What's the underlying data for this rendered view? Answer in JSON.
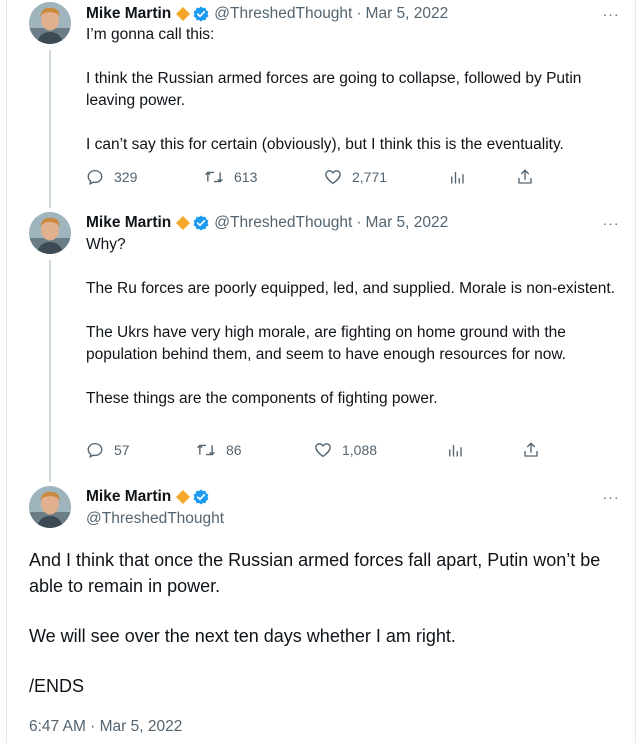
{
  "tweets": [
    {
      "author": {
        "name": "Mike Martin",
        "handle": "@ThreshedThought"
      },
      "separator": "·",
      "date": "Mar 5, 2022",
      "more_label": "···",
      "paragraphs": [
        "I’m gonna call this:",
        "I think the Russian armed forces are going to collapse, followed by Putin leaving power.",
        "I can’t say this for certain (obviously), but I think this is the eventuality."
      ],
      "stats": {
        "replies": "329",
        "retweets": "613",
        "likes": "2,771"
      }
    },
    {
      "author": {
        "name": "Mike Martin",
        "handle": "@ThreshedThought"
      },
      "separator": "·",
      "date": "Mar 5, 2022",
      "more_label": "···",
      "paragraphs": [
        "Why?",
        "The Ru forces are poorly equipped, led, and supplied. Morale is non-existent.",
        "The Ukrs have very high morale, are fighting on home ground with the population behind them, and seem to have enough resources for now.",
        "These things are the components of fighting power."
      ],
      "stats": {
        "replies": "57",
        "retweets": "86",
        "likes": "1,088"
      }
    }
  ],
  "main_tweet": {
    "author": {
      "name": "Mike Martin",
      "handle": "@ThreshedThought"
    },
    "more_label": "···",
    "paragraphs": [
      "And I think that once the Russian armed forces fall apart, Putin won’t be able to remain in power.",
      "We will see over the next ten days whether I am right.",
      "/ENDS"
    ],
    "timestamp": "6:47 AM · Mar 5, 2022"
  },
  "colors": {
    "text": "#0f1419",
    "secondary": "#536471",
    "verified_blue": "#1d9bf0",
    "gold_badge": "#f4a72b",
    "thread_line": "#cfd9de"
  },
  "icons": {
    "reply": "reply-icon",
    "retweet": "retweet-icon",
    "like": "heart-icon",
    "views": "views-icon",
    "share": "share-icon",
    "verified": "verified-badge-icon",
    "affiliate": "gold-diamond-badge-icon"
  }
}
